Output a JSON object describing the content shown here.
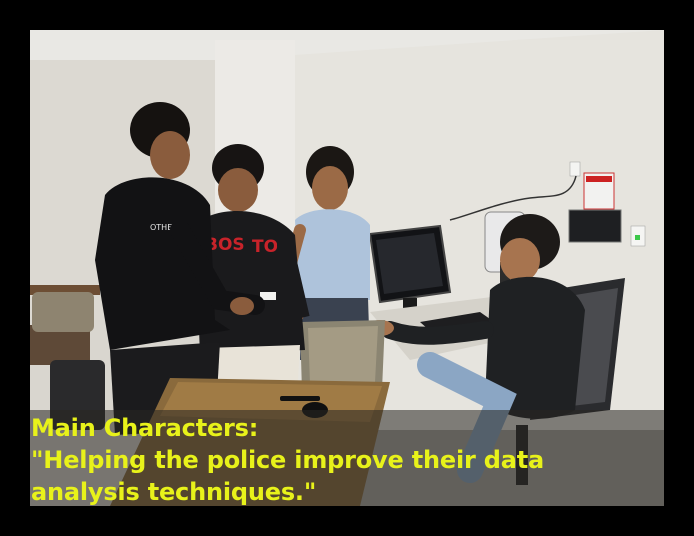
{
  "caption": {
    "line1": "Main Characters:",
    "line2": "\"Helping the police improve their data",
    "line3": "analysis techniques.\"",
    "color": "#e8f21a"
  },
  "scene": {
    "sweatshirt_text_1": "BOS",
    "sweatshirt_text_2": "TON",
    "hoodie_text": "OTHER"
  },
  "colors": {
    "frame": "#000000",
    "wall": "#e4e2dc",
    "table": "#8a6a3c"
  }
}
